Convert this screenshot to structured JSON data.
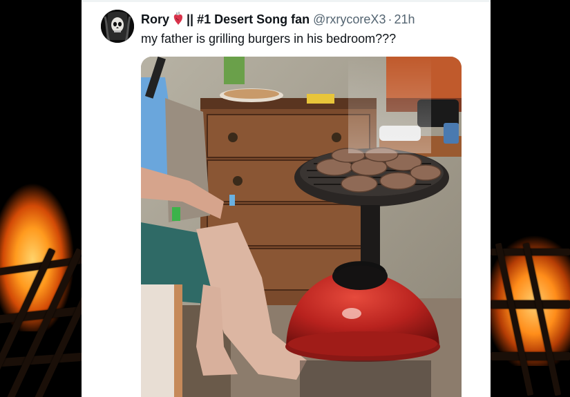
{
  "tweet": {
    "display_name": "Rory",
    "name_suffix": "|| #1 Desert Song fan",
    "handle": "@rxrycoreX3",
    "separator": "·",
    "time": "21h",
    "text": "my father is grilling burgers in his bedroom???"
  },
  "icons": {
    "heart": "anatomical-heart-icon",
    "avatar": "skull-avatar"
  },
  "colors": {
    "text_primary": "#0f1419",
    "text_secondary": "#536471",
    "grill_lid": "#b8221e",
    "fire": "#ff9a1e"
  }
}
